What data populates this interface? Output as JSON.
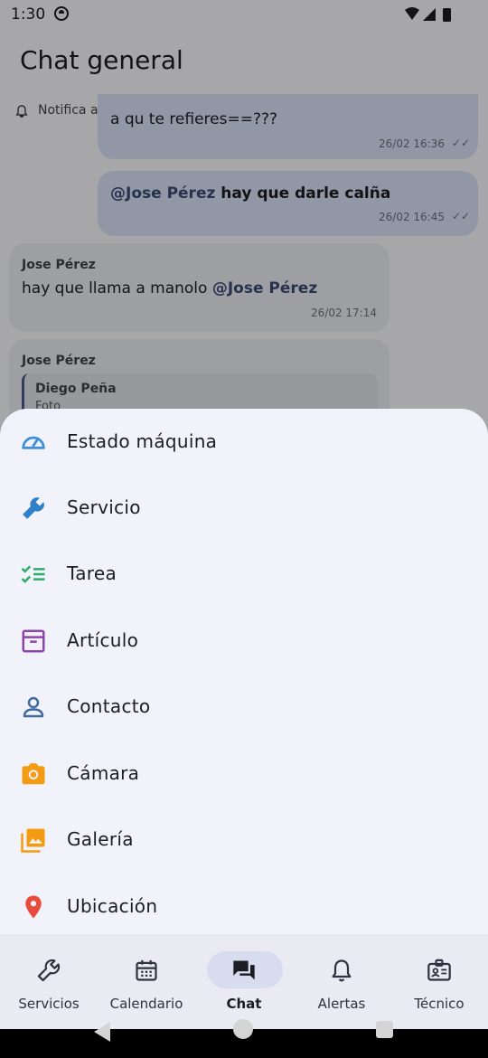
{
  "status_bar": {
    "time": "1:30"
  },
  "header": {
    "title": "Chat general",
    "notification_label": "Notifica a"
  },
  "chat": {
    "messages": [
      {
        "text": "a qu te refieres==???",
        "time": "26/02 16:36"
      },
      {
        "mention": "@Jose Pérez",
        "text": " hay que darle calña",
        "time": "26/02 16:45"
      },
      {
        "sender": "Jose Pérez",
        "text": "hay que llama a manolo ",
        "mention": "@Jose Pérez",
        "time": "26/02 17:14"
      },
      {
        "sender": "Jose Pérez",
        "quote_sender": "Diego Peña",
        "quote_text": "Foto"
      }
    ]
  },
  "sheet": {
    "items": [
      {
        "label": "Estado máquina",
        "icon": "gauge-icon",
        "color": "#3a8fd9"
      },
      {
        "label": "Servicio",
        "icon": "wrench-icon",
        "color": "#2f80c9"
      },
      {
        "label": "Tarea",
        "icon": "checklist-icon",
        "color": "#2eae6b"
      },
      {
        "label": "Artículo",
        "icon": "archive-box-icon",
        "color": "#8e44ad"
      },
      {
        "label": "Contacto",
        "icon": "person-icon",
        "color": "#3f6aa0"
      },
      {
        "label": "Cámara",
        "icon": "camera-icon",
        "color": "#f39c12"
      },
      {
        "label": "Galería",
        "icon": "gallery-icon",
        "color": "#f39c12"
      },
      {
        "label": "Ubicación",
        "icon": "location-pin-icon",
        "color": "#e74c3c"
      }
    ]
  },
  "bottom_nav": {
    "items": [
      {
        "label": "Servicios",
        "icon": "wrench-icon"
      },
      {
        "label": "Calendario",
        "icon": "calendar-icon"
      },
      {
        "label": "Chat",
        "icon": "chat-icon",
        "active": true
      },
      {
        "label": "Alertas",
        "icon": "bell-icon"
      },
      {
        "label": "Técnico",
        "icon": "id-badge-icon"
      }
    ]
  }
}
